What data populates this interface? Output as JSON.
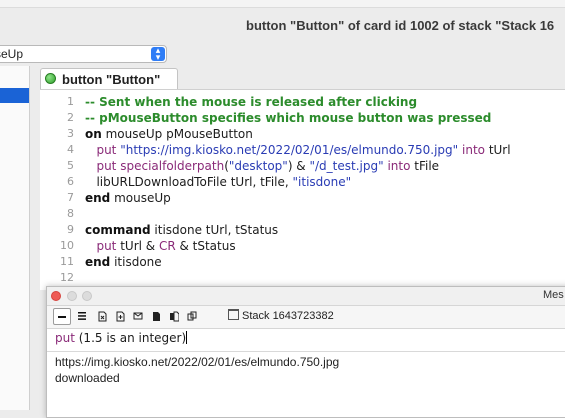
{
  "window": {
    "title": "button \"Button\" of card id 1002 of stack \"Stack 16"
  },
  "handler_select": {
    "value": "seUp"
  },
  "editor_tab": {
    "label": "button \"Button\""
  },
  "code": {
    "line_numbers": [
      "1",
      "2",
      "3",
      "4",
      "5",
      "6",
      "7",
      "8",
      "9",
      "10",
      "11",
      "12"
    ],
    "lines": [
      [
        {
          "t": "-- Sent when the mouse is released after clicking",
          "c": "cmt"
        }
      ],
      [
        {
          "t": "-- pMouseButton specifies which mouse button was pressed",
          "c": "cmt"
        }
      ],
      [
        {
          "t": "on",
          "c": "kw"
        },
        {
          "t": " mouseUp pMouseButton",
          "c": ""
        }
      ],
      [
        {
          "t": "   ",
          "c": ""
        },
        {
          "t": "put",
          "c": "cmd"
        },
        {
          "t": " ",
          "c": ""
        },
        {
          "t": "\"https://img.kiosko.net/2022/02/01/es/elmundo.750.jpg\"",
          "c": "str"
        },
        {
          "t": " ",
          "c": ""
        },
        {
          "t": "into",
          "c": "cmd"
        },
        {
          "t": " tUrl",
          "c": ""
        }
      ],
      [
        {
          "t": "   ",
          "c": ""
        },
        {
          "t": "put",
          "c": "cmd"
        },
        {
          "t": " ",
          "c": ""
        },
        {
          "t": "specialfolderpath",
          "c": "cmd"
        },
        {
          "t": "(",
          "c": ""
        },
        {
          "t": "\"desktop\"",
          "c": "str"
        },
        {
          "t": ") & ",
          "c": ""
        },
        {
          "t": "\"/d_test.jpg\"",
          "c": "str"
        },
        {
          "t": " ",
          "c": ""
        },
        {
          "t": "into",
          "c": "cmd"
        },
        {
          "t": " tFile",
          "c": ""
        }
      ],
      [
        {
          "t": "   libURLDownloadToFile tUrl, tFile, ",
          "c": ""
        },
        {
          "t": "\"itisdone\"",
          "c": "str"
        }
      ],
      [
        {
          "t": "end",
          "c": "kw"
        },
        {
          "t": " mouseUp",
          "c": ""
        }
      ],
      [],
      [
        {
          "t": "command",
          "c": "kw"
        },
        {
          "t": " itisdone tUrl, tStatus",
          "c": ""
        }
      ],
      [
        {
          "t": "   ",
          "c": ""
        },
        {
          "t": "put",
          "c": "cmd"
        },
        {
          "t": " tUrl & ",
          "c": ""
        },
        {
          "t": "CR",
          "c": "cmd"
        },
        {
          "t": " & tStatus",
          "c": ""
        }
      ],
      [
        {
          "t": "end",
          "c": "kw"
        },
        {
          "t": " itisdone",
          "c": ""
        }
      ],
      []
    ]
  },
  "message_box": {
    "title": "Mes",
    "stack_selector": "Stack 1643723382",
    "command": {
      "put_keyword": "put",
      "rest": " (1.5 is an integer)"
    },
    "output_lines": [
      "https://img.kiosko.net/2022/02/01/es/elmundo.750.jpg",
      "downloaded"
    ]
  },
  "colors": {
    "comment": "#2c8c2c",
    "command": "#8a2a78",
    "string": "#2a3cb4",
    "selection": "#1a63d6"
  }
}
